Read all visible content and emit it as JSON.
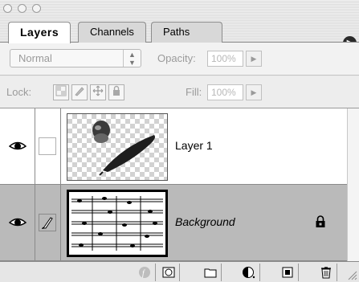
{
  "tabs": [
    {
      "label": "Layers",
      "active": true
    },
    {
      "label": "Channels",
      "active": false
    },
    {
      "label": "Paths",
      "active": false
    }
  ],
  "options": {
    "blend_mode": "Normal",
    "opacity_label": "Opacity:",
    "opacity_value": "100%",
    "lock_label": "Lock:",
    "fill_label": "Fill:",
    "fill_value": "100%"
  },
  "layers": [
    {
      "name": "Layer 1",
      "visible": true,
      "selected": false,
      "locked": false,
      "icon": "feather-thumbnail"
    },
    {
      "name": "Background",
      "visible": true,
      "selected": true,
      "locked": true,
      "icon": "sheet-music-thumbnail"
    }
  ],
  "bottom_icons": [
    "layer-style-icon",
    "layer-mask-icon",
    "new-layer-set-icon",
    "new-adjustment-layer-icon",
    "new-layer-icon",
    "trash-icon"
  ],
  "colors": {
    "selected_row": "#bababa",
    "panel_bg": "#e8e8e8"
  }
}
